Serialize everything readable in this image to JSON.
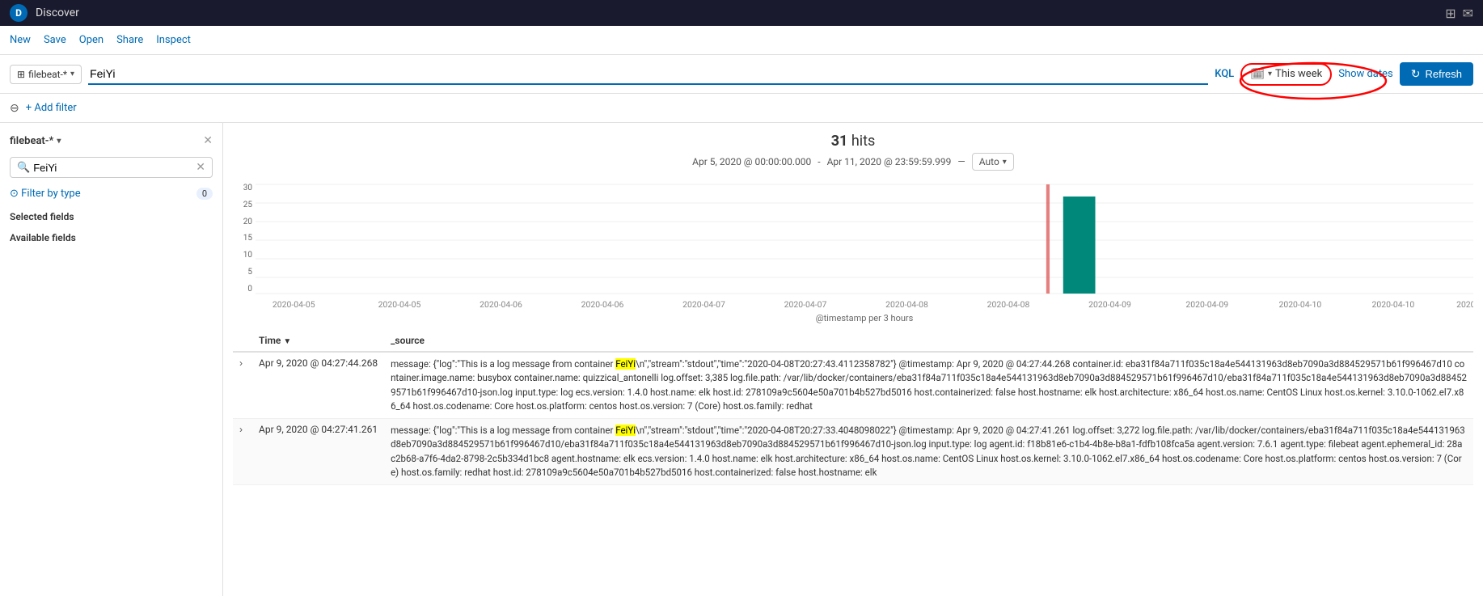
{
  "app": {
    "title": "Discover",
    "logo_letter": "D"
  },
  "nav": {
    "items": [
      "New",
      "Save",
      "Open",
      "Share",
      "Inspect"
    ]
  },
  "search": {
    "index": "filebeat-*",
    "query": "FeiYi",
    "kql_label": "KQL",
    "time_period": "This week",
    "show_dates_label": "Show dates",
    "refresh_label": "Refresh"
  },
  "filter_bar": {
    "add_filter_label": "+ Add filter"
  },
  "sidebar": {
    "index_name": "filebeat-*",
    "search_placeholder": "FeiYi",
    "filter_by_type_label": "Filter by type",
    "filter_count": "0",
    "selected_fields_label": "Selected fields",
    "available_fields_label": "Available fields"
  },
  "results": {
    "hits": "31",
    "hits_label": "hits",
    "date_from": "Apr 5, 2020 @ 00:00:00.000",
    "date_to": "Apr 11, 2020 @ 23:59:59.999",
    "auto_label": "Auto",
    "chart_xlabel": "@timestamp per 3 hours",
    "y_axis": [
      "30",
      "25",
      "20",
      "15",
      "10",
      "5",
      "0"
    ]
  },
  "table": {
    "col_time": "Time",
    "col_source": "_source",
    "rows": [
      {
        "time": "Apr 9, 2020 @ 04:27:44.268",
        "source": "message: {\"log\":\"This is a log message from container FeiYi\\n\",\"stream\":\"stdout\",\"time\":\"2020-04-08T20:27:43.4112358782\"} @timestamp: Apr 9, 2020 @ 04:27:44.268 container.id: eba31f84a711f035c18a4e544131963d8eb7090a3d884529571b61f996467d10 container.image.name: busybox container.name: quizzical_antonelli log.offset: 3,385 log.file.path: /var/lib/docker/containers/eba31f84a711f035c18a4e544131963d8eb7090a3d884529571b61f996467d10/eba31f84a711f035c18a4e544131963d8eb7090a3d884529571b61f996467d10-json.log input.type: log ecs.version: 1.4.0 host.name: elk host.id: 278109a9c5604e50a701b4b527bd5016 host.containerized: false host.hostname: elk host.architecture: x86_64 host.os.name: CentOS Linux host.os.kernel: 3.10.0-1062.el7.x86_64 host.os.codename: Core host.os.platform: centos host.os.version: 7 (Core) host.os.family: redhat",
        "highlight_text": "FeiYi"
      },
      {
        "time": "Apr 9, 2020 @ 04:27:41.261",
        "source": "message: {\"log\":\"This is a log message from container FeiYi\\n\",\"stream\":\"stdout\",\"time\":\"2020-04-08T20:27:33.4048098022\"} @timestamp: Apr 9, 2020 @ 04:27:41.261 log.offset: 3,272 log.file.path: /var/lib/docker/containers/eba31f84a711f035c18a4e544131963d8eb7090a3d884529571b61f996467d10/eba31f84a711f035c18a4e544131963d8eb7090a3d884529571b61f996467d10-json.log input.type: log agent.id: f18b81e6-c1b4-4b8e-b8a1-fdfb108fca5a agent.version: 7.6.1 agent.type: filebeat agent.ephemeral_id: 28ac2b68-a7f6-4da2-8798-2c5b334d1bc8 agent.hostname: elk ecs.version: 1.4.0 host.name: elk host.architecture: x86_64 host.os.name: CentOS Linux host.os.kernel: 3.10.0-1062.el7.x86_64 host.os.codename: Core host.os.platform: centos host.os.version: 7 (Core) host.os.family: redhat host.id: 278109a9c5604e50a701b4b527bd5016 host.containerized: false host.hostname: elk",
        "highlight_text": "FeiYi"
      }
    ]
  }
}
